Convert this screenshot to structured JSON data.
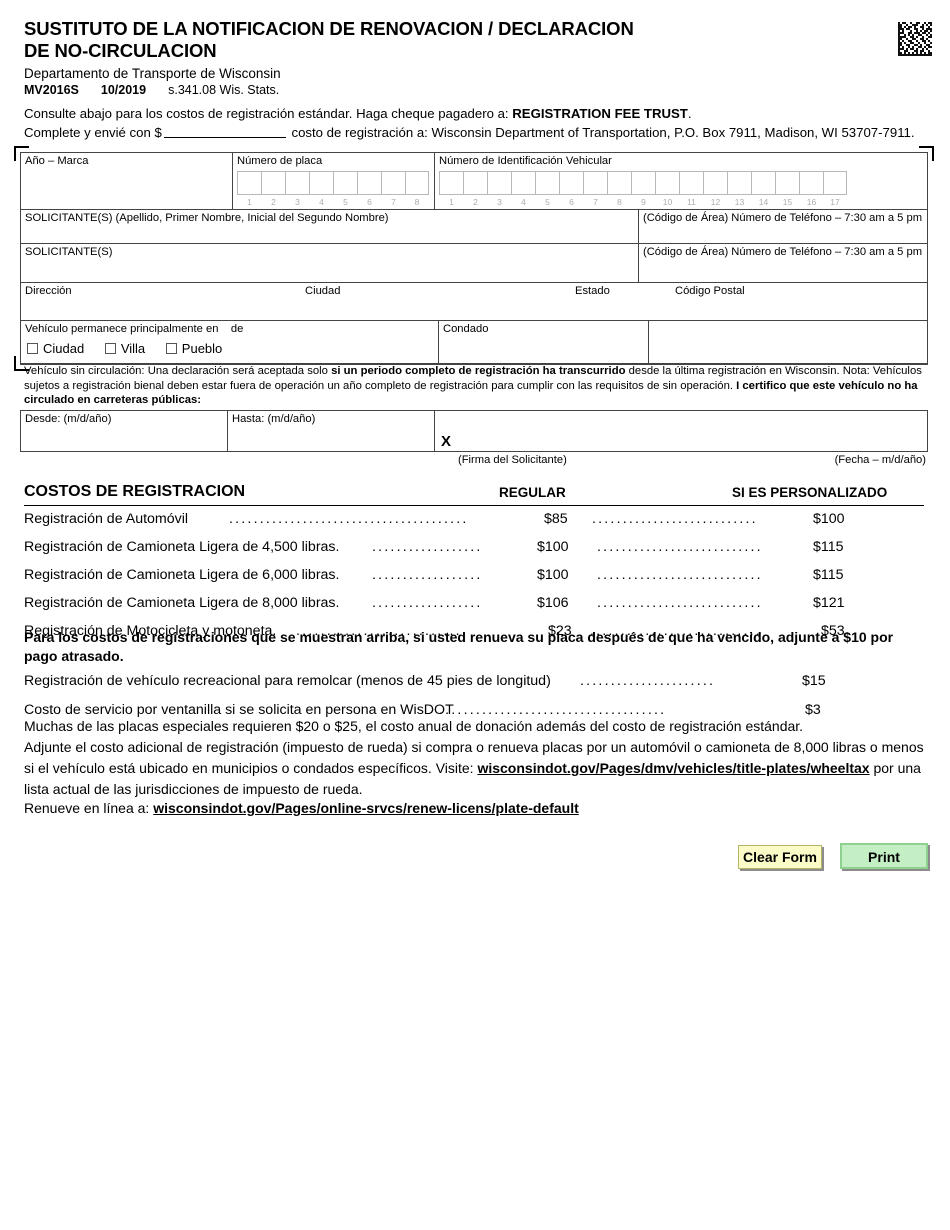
{
  "header": {
    "title_line1": "SUSTITUTO DE LA NOTIFICACION DE RENOVACION / DECLARACION",
    "title_line2": "DE NO-CIRCULACION",
    "department": "Departamento de Transporte de Wisconsin",
    "form_number": "MV2016S",
    "revision": "10/2019",
    "statute": "s.341.08 Wis. Stats.",
    "barcode": "datamatrix-barcode"
  },
  "instructions": {
    "line1_a": "Consulte abajo para los costos de registración estándar. Haga cheque pagadero a: ",
    "line1_b": "REGISTRATION FEE TRUST",
    "line1_c": ".",
    "line2_a": "Complete y envié con $",
    "line2_b": " costo de registración a: Wisconsin Department of Transportation, P.O. Box 7911, Madison, WI 53707-7911."
  },
  "form_fields": {
    "year_make": "Año – Marca",
    "plate_number": "Número de placa",
    "plate_cells": [
      "1",
      "2",
      "3",
      "4",
      "5",
      "6",
      "7",
      "8"
    ],
    "vin": "Número de Identificación Vehicular",
    "vin_cells": [
      "1",
      "2",
      "3",
      "4",
      "5",
      "6",
      "7",
      "8",
      "9",
      "10",
      "11",
      "12",
      "13",
      "14",
      "15",
      "16",
      "17"
    ],
    "applicant1": "SOLICITANTE(S) (Apellido, Primer Nombre, Inicial del Segundo Nombre)",
    "applicant2": "SOLICITANTE(S)",
    "phone1": "(Código de Área) Número de Teléfono – 7:30 am a 5 pm",
    "phone2": "(Código de Área) Número de Teléfono – 7:30 am a 5 pm",
    "address": "Dirección",
    "city": "Ciudad",
    "state": "Estado",
    "zip": "Código Postal",
    "stays_label_a": "Vehículo permanece principalmente en",
    "stays_label_b": "de",
    "opt_city": "Ciudad",
    "opt_village": "Villa",
    "opt_town": "Pueblo",
    "county": "Condado"
  },
  "certification": {
    "t1": "Vehículo sin circulación: Una declaración será aceptada solo ",
    "t2": "si un periodo completo de registración ha transcurrido",
    "t3": " desde la última registración en Wisconsin. Nota: Vehículos sujetos a registración bienal deben estar fuera de operación un año completo de registración para cumplir con las requisitos de sin operación. ",
    "t4": "I certifico que este vehículo no ha circulado en carreteras públicas:"
  },
  "signature_section": {
    "from": "Desde: (m/d/año)",
    "to": "Hasta: (m/d/año)",
    "x_mark": "X",
    "caption_signature": "(Firma del Solicitante)",
    "caption_date": "(Fecha – m/d/año)"
  },
  "fee_table": {
    "title": "COSTOS DE REGISTRACION",
    "col_regular": "REGULAR",
    "col_personalized": "SI ES PERSONALIZADO",
    "rows": [
      {
        "name": "Registración de Automóvil",
        "regular": "$85",
        "personalized": "$100"
      },
      {
        "name": "Registración de Camioneta Ligera  de 4,500 libras.",
        "regular": "$100",
        "personalized": "$115"
      },
      {
        "name": "Registración de Camioneta Ligera  de 6,000 libras.",
        "regular": "$100",
        "personalized": "$115"
      },
      {
        "name": "Registración de Camioneta Ligera  de 8,000 libras.",
        "regular": "$106",
        "personalized": "$121"
      },
      {
        "name": "Registración de Motocicleta y motoneta.",
        "regular": "$23",
        "personalized": "$53"
      }
    ]
  },
  "late_fee_note": "Para los costos de registraciones que se muestran arriba, si usted renueva su placa después de que ha vencido, adjunte a $10 por pago atrasado.",
  "extra_fees": [
    {
      "name": "Registración de vehículo recreacional para remolcar (menos de 45 pies de longitud)",
      "value": "$15"
    },
    {
      "name": "Costo de servicio por ventanilla si se solicita en persona en WisDOT",
      "value": "$3"
    }
  ],
  "special_plates": {
    "p1": "Muchas de las placas especiales requieren $20 o $25, el costo anual de donación además del costo de registración estándar.",
    "p2": "Adjunte el costo adicional de registración (impuesto de rueda) si compra o renueva placas por un automóvil o camioneta de 8,000 libras o menos si el vehículo está ubicado en municipios o condados específicos. Visite: ",
    "link1": "wisconsindot.gov/Pages/dmv/vehicles/title-plates/wheeltax",
    "p3": " por una lista actual de las jurisdicciones de impuesto de rueda."
  },
  "renew_online": {
    "label": "Renueve en línea a: ",
    "link": "wisconsindot.gov/Pages/online-srvcs/renew-licens/plate-default"
  },
  "buttons": {
    "clear": "Clear Form",
    "print": "Print"
  }
}
